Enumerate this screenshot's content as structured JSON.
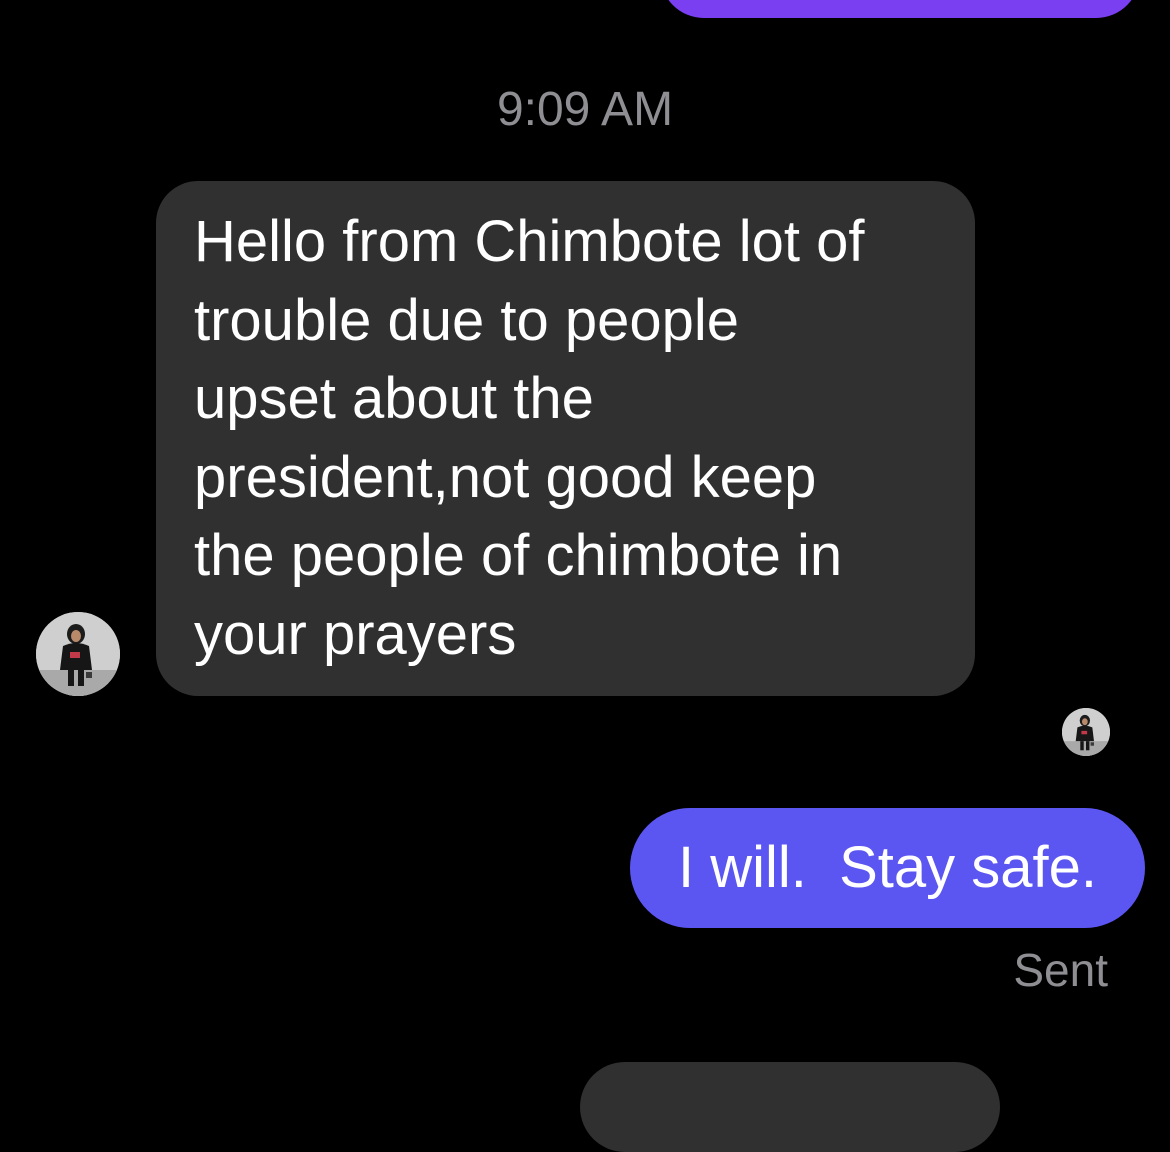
{
  "conversation": {
    "timestamp": "9:09 AM",
    "messages": [
      {
        "direction": "incoming",
        "text": "Hello from Chimbote lot of\ntrouble due to people\nupset about the\npresident,not good keep\nthe people of chimbote in\nyour prayers"
      },
      {
        "direction": "outgoing",
        "text": "I will.  Stay safe.",
        "status": "Sent"
      }
    ]
  },
  "colors": {
    "background": "#000000",
    "incoming_bubble": "#303030",
    "outgoing_bubble": "#5b55f2",
    "previous_outgoing_bubble": "#7b3ff2",
    "secondary_text": "#8e8e93"
  },
  "icons": {
    "sender_avatar": "avatar-photo-icon",
    "read_receipt_avatar": "avatar-photo-icon"
  }
}
